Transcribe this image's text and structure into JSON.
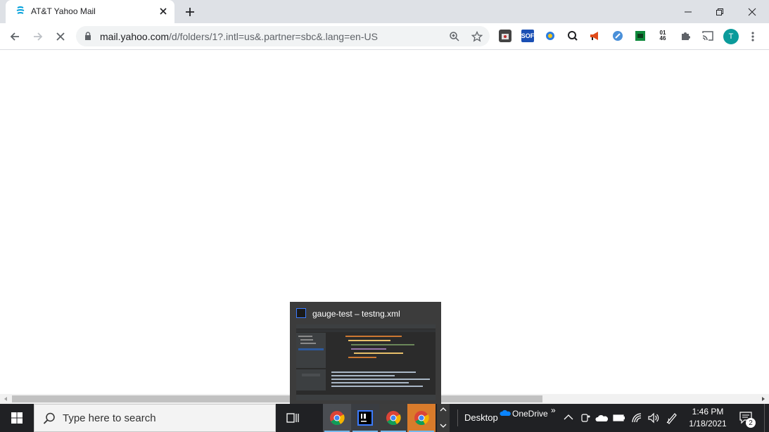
{
  "browser": {
    "tab_title": "AT&T Yahoo Mail",
    "url_host": "mail.yahoo.com",
    "url_path": "/d/folders/1?.intl=us&.partner=sbc&.lang=en-US",
    "avatar_letter": "T",
    "extensions": [
      "extension-1-icon",
      "sof-extension-icon",
      "extension-3-icon",
      "search-extension-icon",
      "megaphone-extension-icon",
      "extension-6-icon",
      "terminal-extension-icon",
      "clock-extension-icon",
      "puzzle-icon",
      "cast-icon"
    ],
    "ext_sof": "SOF",
    "ext_clock_top": "01",
    "ext_clock_bottom": "46"
  },
  "preview": {
    "title": "gauge-test – testng.xml"
  },
  "taskbar": {
    "search_placeholder": "Type here to search",
    "desktop_label": "Desktop",
    "onedrive_label": "OneDrive",
    "chevron": "»",
    "time": "1:46 PM",
    "date": "1/18/2021",
    "notification_count": "2"
  },
  "colors": {
    "tabstrip": "#dee1e6",
    "taskbar": "#202124",
    "accent": "#0b9b9b"
  }
}
